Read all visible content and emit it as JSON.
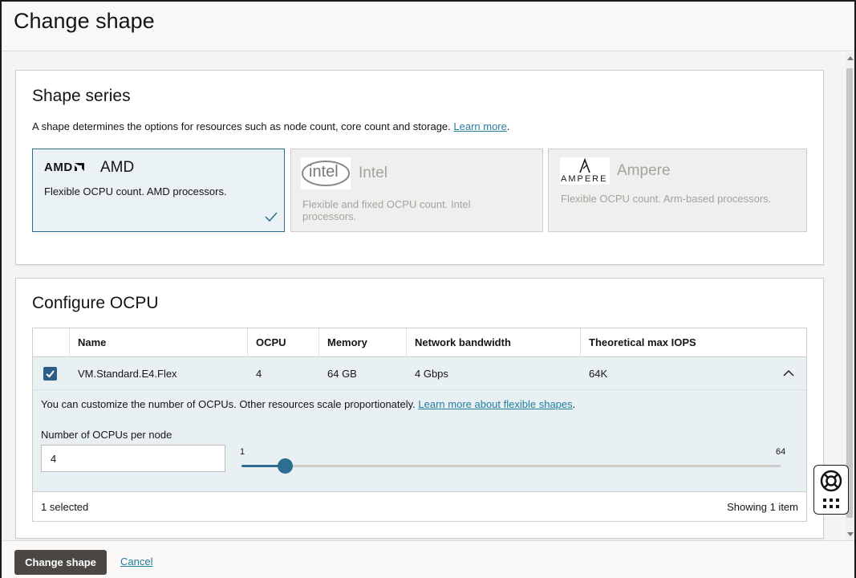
{
  "header": {
    "title": "Change shape"
  },
  "shape_series": {
    "title": "Shape series",
    "description": "A shape determines the options for resources such as node count, core count and storage.",
    "learn_more": "Learn more",
    "period": ".",
    "cards": [
      {
        "logo": "AMD",
        "name": "AMD",
        "description": "Flexible OCPU count. AMD processors.",
        "selected": true,
        "disabled": false
      },
      {
        "logo": "intel",
        "name": "Intel",
        "description": "Flexible and fixed OCPU count. Intel processors.",
        "selected": false,
        "disabled": true
      },
      {
        "logo": "AMPERE",
        "name": "Ampere",
        "description": "Flexible OCPU count. Arm-based processors.",
        "selected": false,
        "disabled": true
      }
    ]
  },
  "configure_ocpu": {
    "title": "Configure OCPU",
    "columns": [
      "Name",
      "OCPU",
      "Memory",
      "Network bandwidth",
      "Theoretical max IOPS"
    ],
    "row": {
      "checked": true,
      "name": "VM.Standard.E4.Flex",
      "ocpu": "4",
      "memory": "64 GB",
      "network": "4 Gbps",
      "iops": "64K"
    },
    "expand_message": "You can customize the number of OCPUs. Other resources scale proportionately.",
    "expand_link": "Learn more about flexible shapes",
    "expand_period": ".",
    "field_label": "Number of OCPUs per node",
    "field_value": "4",
    "slider": {
      "min_label": "1",
      "max_label": "64",
      "min": 1,
      "max": 64,
      "value": 4
    },
    "selected_count": "1 selected",
    "showing": "Showing 1 item"
  },
  "footer": {
    "primary_label": "Change shape",
    "cancel_label": "Cancel"
  },
  "colors": {
    "accent": "#2c6e8d",
    "link": "#227e9e",
    "primary_button": "#4a4744",
    "row_highlight": "#e8f0f3"
  },
  "icons": [
    "amd-logo-icon",
    "intel-logo-icon",
    "ampere-logo-icon",
    "checkmark-icon",
    "chevron-up-icon",
    "lifebuoy-icon",
    "grid-dots-icon"
  ]
}
